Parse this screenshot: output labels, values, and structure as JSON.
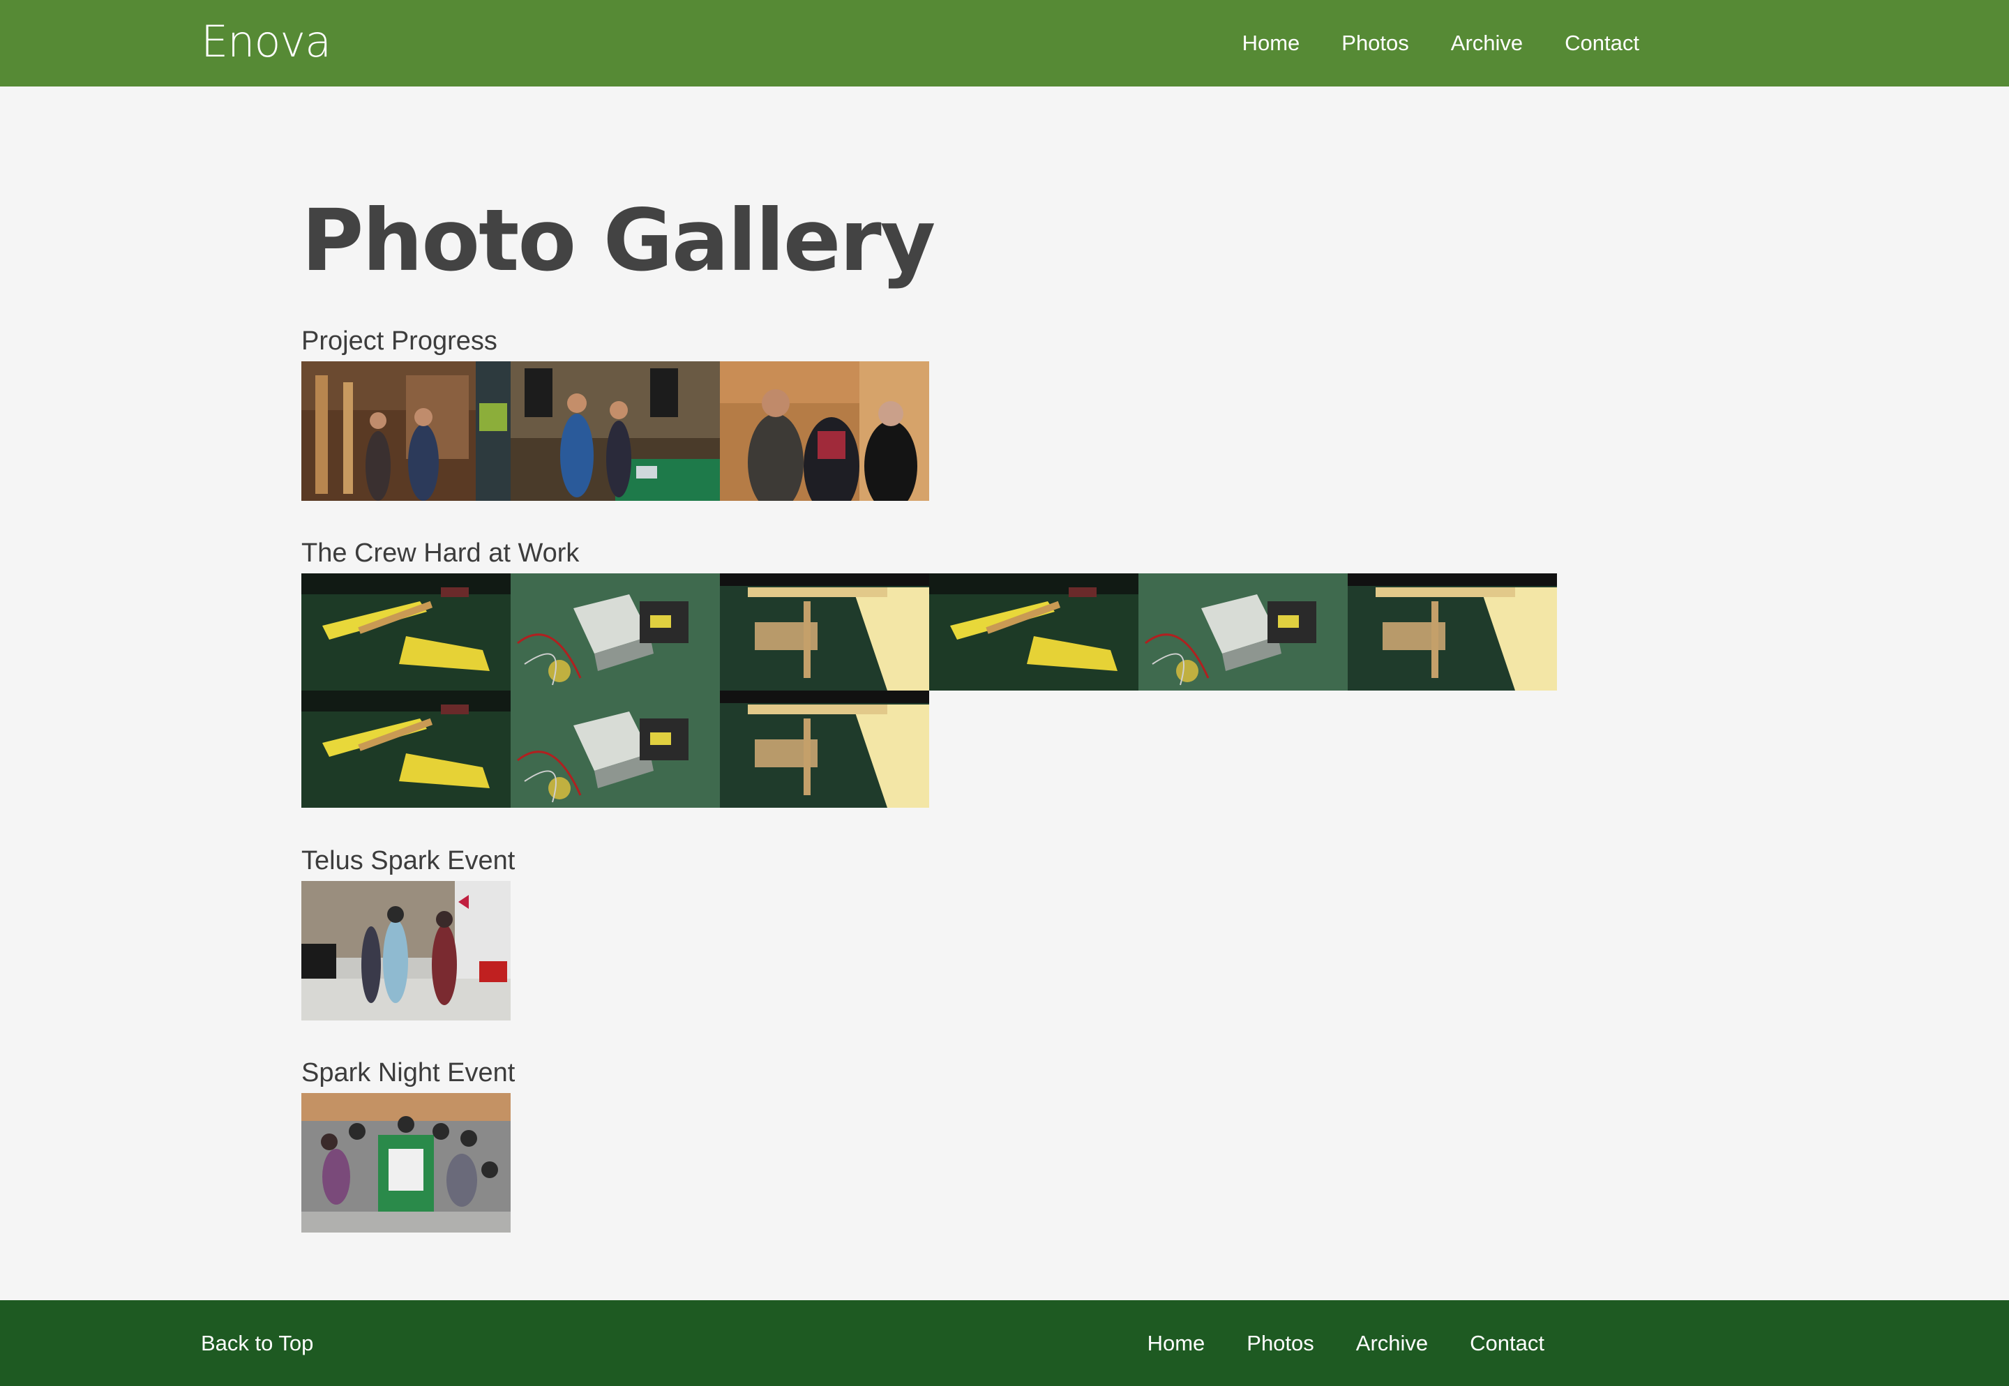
{
  "site": {
    "brand": "Enova",
    "nav": [
      "Home",
      "Photos",
      "Archive",
      "Contact"
    ]
  },
  "page": {
    "title": "Photo Gallery"
  },
  "albums": [
    {
      "title": "Project Progress",
      "photos": [
        "project-photo",
        "project-photo",
        "project-photo"
      ]
    },
    {
      "title": "The Crew Hard at Work",
      "photos": [
        "craft-photo",
        "soldering-photo",
        "craft-photo",
        "craft-photo",
        "soldering-photo",
        "craft-photo",
        "craft-photo",
        "soldering-photo",
        "craft-photo"
      ]
    },
    {
      "title": "Telus Spark Event",
      "photos": [
        "event-photo"
      ]
    },
    {
      "title": "Spark Night Event",
      "photos": [
        "group-photo"
      ]
    }
  ],
  "footer": {
    "back_to_top": "Back to Top",
    "nav": [
      "Home",
      "Photos",
      "Archive",
      "Contact"
    ]
  },
  "colors": {
    "header": "#568a35",
    "footer": "#1e5a22",
    "background": "#f5f5f5",
    "heading": "#434343"
  }
}
